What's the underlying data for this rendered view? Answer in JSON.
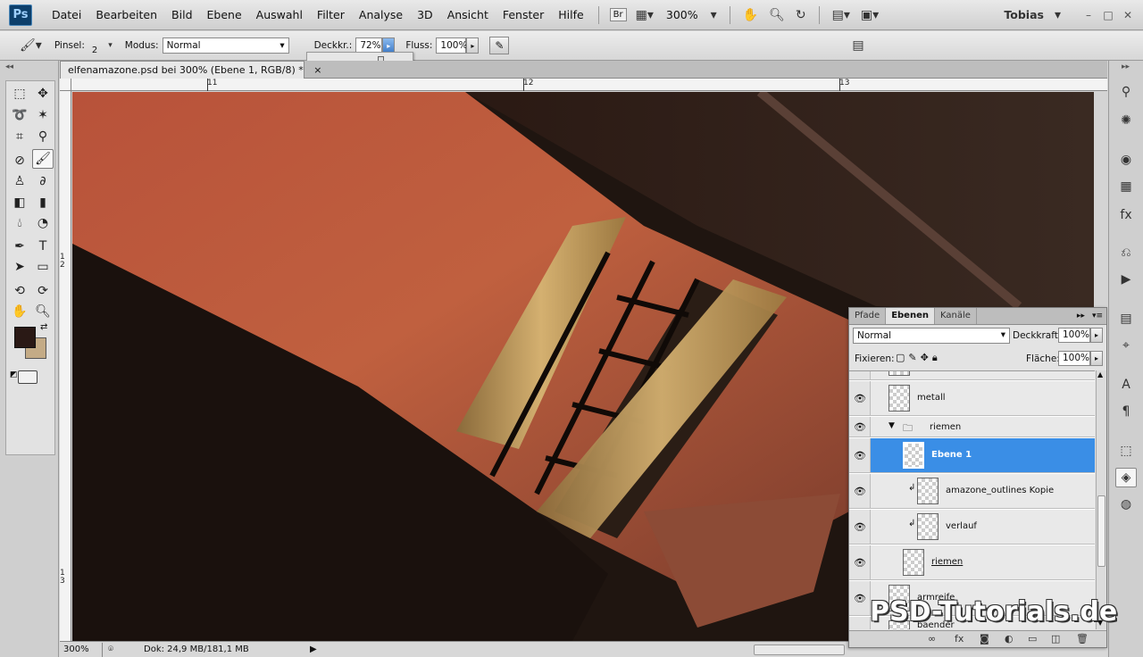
{
  "app": {
    "logo": "Ps"
  },
  "menu": {
    "items": [
      "Datei",
      "Bearbeiten",
      "Bild",
      "Ebene",
      "Auswahl",
      "Filter",
      "Analyse",
      "3D",
      "Ansicht",
      "Fenster",
      "Hilfe"
    ],
    "bridge": "Br",
    "zoom": "300%",
    "user": "Tobias"
  },
  "options": {
    "pinsel_label": "Pinsel:",
    "pinsel_size": "2",
    "modus_label": "Modus:",
    "modus_value": "Normal",
    "deckkr_label": "Deckkr.:",
    "deckkr_value": "72%",
    "fluss_label": "Fluss:",
    "fluss_value": "100%",
    "opacity_slider_level": 0.72
  },
  "document": {
    "tab_title": "elfenamazone.psd bei 300% (Ebene 1, RGB/8) *",
    "close_symbol": "×",
    "ruler_top": [
      "11",
      "12",
      "13"
    ],
    "ruler_left": [
      "1\n2",
      "1\n3"
    ],
    "status_zoom": "300%",
    "status_info": "Dok: 24,9 MB/181,1 MB"
  },
  "layers_panel": {
    "tabs": [
      "Pfade",
      "Ebenen",
      "Kanäle"
    ],
    "active_tab": "Ebenen",
    "blend_mode": "Normal",
    "opacity_label": "Deckkraft:",
    "opacity_value": "100%",
    "lock_label": "Fixieren:",
    "fill_label": "Fläche:",
    "fill_value": "100%",
    "layers": [
      {
        "name": "metall",
        "indent": 0,
        "selected": false
      },
      {
        "name": "riemen",
        "indent": 1,
        "group": true,
        "selected": false
      },
      {
        "name": "Ebene 1",
        "indent": 2,
        "selected": true
      },
      {
        "name": "amazone_outlines Kopie",
        "indent": 3,
        "clipped": true,
        "selected": false
      },
      {
        "name": "verlauf",
        "indent": 3,
        "clipped": true,
        "selected": false
      },
      {
        "name": "riemen",
        "indent": 2,
        "selected": false,
        "underlined": true
      },
      {
        "name": "armreife",
        "indent": 0,
        "selected": false
      },
      {
        "name": "baender",
        "indent": 0,
        "selected": false
      }
    ]
  },
  "watermark": "PSD-Tutorials.de",
  "colors": {
    "foreground": "#2a1915",
    "background": "#c4ab86",
    "selection": "#3a8ee6"
  }
}
